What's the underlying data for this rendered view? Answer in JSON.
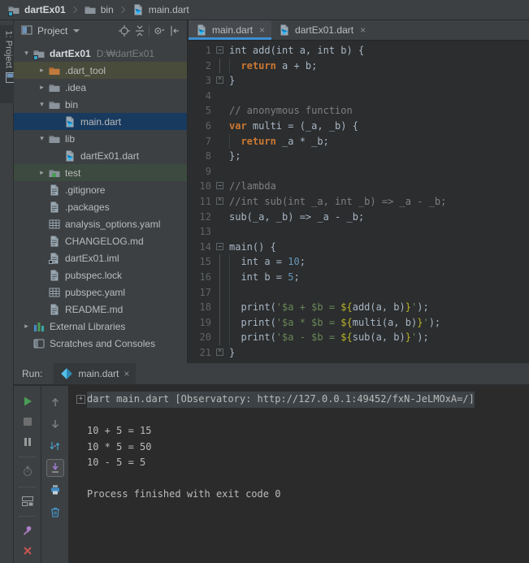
{
  "colors": {
    "accent_blue": "#3D8FD1",
    "selection_bg": "#173A5E",
    "excluded_row_bg": "#494B3B",
    "test_row_bg": "#3C4A40",
    "syntax": {
      "d": "#A9B7C6",
      "k": "#CC7832",
      "n": "#6897BB",
      "c": "#808080",
      "s": "#6A8759",
      "i": "#BBB529"
    },
    "run_green": "#499C54",
    "close_red": "#C75450"
  },
  "breadcrumb": {
    "items": [
      {
        "label": "dartEx01",
        "icon": "folder-project",
        "bold": true
      },
      {
        "label": "bin",
        "icon": "folder",
        "bold": false
      },
      {
        "label": "main.dart",
        "icon": "dart-file",
        "bold": false
      }
    ]
  },
  "tool_window_bar": {
    "project_tab_label": "1: Project"
  },
  "project_panel": {
    "title": "Project",
    "header_icons": [
      "locate",
      "collapse-all",
      "sep",
      "gear",
      "hide-panel"
    ],
    "tree": [
      {
        "indent": 0,
        "arrow": "down",
        "icon": "folder-project",
        "label": "dartEx01",
        "suffix": "D:₩dartEx01",
        "root": true
      },
      {
        "indent": 1,
        "arrow": "right",
        "icon": "folder-excluded",
        "label": ".dart_tool",
        "bg": "excl"
      },
      {
        "indent": 1,
        "arrow": "right",
        "icon": "folder",
        "label": ".idea"
      },
      {
        "indent": 1,
        "arrow": "down",
        "icon": "folder",
        "label": "bin"
      },
      {
        "indent": 2,
        "arrow": "none",
        "icon": "dart-file",
        "label": "main.dart",
        "selected": true
      },
      {
        "indent": 1,
        "arrow": "down",
        "icon": "folder",
        "label": "lib"
      },
      {
        "indent": 2,
        "arrow": "none",
        "icon": "dart-file",
        "label": "dartEx01.dart"
      },
      {
        "indent": 1,
        "arrow": "right",
        "icon": "folder-test",
        "label": "test",
        "bg": "test"
      },
      {
        "indent": 1,
        "arrow": "none",
        "icon": "file-text",
        "label": ".gitignore"
      },
      {
        "indent": 1,
        "arrow": "none",
        "icon": "file-text",
        "label": ".packages"
      },
      {
        "indent": 1,
        "arrow": "none",
        "icon": "file-yaml",
        "label": "analysis_options.yaml"
      },
      {
        "indent": 1,
        "arrow": "none",
        "icon": "file-text",
        "label": "CHANGELOG.md"
      },
      {
        "indent": 1,
        "arrow": "none",
        "icon": "file-iml",
        "label": "dartEx01.iml"
      },
      {
        "indent": 1,
        "arrow": "none",
        "icon": "file-text",
        "label": "pubspec.lock"
      },
      {
        "indent": 1,
        "arrow": "none",
        "icon": "file-yaml",
        "label": "pubspec.yaml"
      },
      {
        "indent": 1,
        "arrow": "none",
        "icon": "file-text",
        "label": "README.md"
      },
      {
        "indent": 0,
        "arrow": "right",
        "icon": "libraries",
        "label": "External Libraries"
      },
      {
        "indent": 0,
        "arrow": "none",
        "icon": "scratches",
        "label": "Scratches and Consoles"
      }
    ]
  },
  "editor": {
    "tabs": [
      {
        "label": "main.dart",
        "icon": "dart-file",
        "active": true
      },
      {
        "label": "dartEx01.dart",
        "icon": "dart-file",
        "active": false
      }
    ],
    "lines": [
      {
        "n": 1,
        "fold": "start",
        "segments": [
          [
            "int add(int a, int b) {",
            "d"
          ]
        ]
      },
      {
        "n": 2,
        "foldline": true,
        "guide": true,
        "segments": [
          [
            "  ",
            "d"
          ],
          [
            "return",
            "k"
          ],
          [
            " a + b;",
            "d"
          ]
        ]
      },
      {
        "n": 3,
        "fold": "end",
        "segments": [
          [
            "}",
            "d"
          ]
        ]
      },
      {
        "n": 4,
        "segments": []
      },
      {
        "n": 5,
        "segments": [
          [
            "// anonymous function",
            "c"
          ]
        ]
      },
      {
        "n": 6,
        "segments": [
          [
            "var",
            "k"
          ],
          [
            " multi = (_a, _b) {",
            "d"
          ]
        ]
      },
      {
        "n": 7,
        "guide": true,
        "segments": [
          [
            "  ",
            "d"
          ],
          [
            "return",
            "k"
          ],
          [
            " _a * _b;",
            "d"
          ]
        ]
      },
      {
        "n": 8,
        "segments": [
          [
            "};",
            "d"
          ]
        ]
      },
      {
        "n": 9,
        "segments": []
      },
      {
        "n": 10,
        "fold": "start",
        "segments": [
          [
            "//lambda",
            "c"
          ]
        ]
      },
      {
        "n": 11,
        "fold": "end",
        "segments": [
          [
            "//int sub(int _a, int _b) => _a - _b;",
            "c"
          ]
        ]
      },
      {
        "n": 12,
        "segments": [
          [
            "sub(_a, _b) => _a - _b;",
            "d"
          ]
        ]
      },
      {
        "n": 13,
        "segments": []
      },
      {
        "n": 14,
        "fold": "start",
        "segments": [
          [
            "main() {",
            "d"
          ]
        ]
      },
      {
        "n": 15,
        "foldline": true,
        "guide": true,
        "segments": [
          [
            "  int a = ",
            "d"
          ],
          [
            "10",
            "n"
          ],
          [
            ";",
            "d"
          ]
        ]
      },
      {
        "n": 16,
        "foldline": true,
        "guide": true,
        "segments": [
          [
            "  int b = ",
            "d"
          ],
          [
            "5",
            "n"
          ],
          [
            ";",
            "d"
          ]
        ]
      },
      {
        "n": 17,
        "foldline": true,
        "guide": true,
        "segments": []
      },
      {
        "n": 18,
        "foldline": true,
        "guide": true,
        "segments": [
          [
            "  print(",
            "d"
          ],
          [
            "'$a + $b = ",
            "s"
          ],
          [
            "${",
            "i"
          ],
          [
            "add(a, b)",
            "d"
          ],
          [
            "}",
            "i"
          ],
          [
            "'",
            "s"
          ],
          [
            ");",
            "d"
          ]
        ]
      },
      {
        "n": 19,
        "foldline": true,
        "guide": true,
        "segments": [
          [
            "  print(",
            "d"
          ],
          [
            "'$a * $b = ",
            "s"
          ],
          [
            "${",
            "i"
          ],
          [
            "multi(a, b)",
            "d"
          ],
          [
            "}",
            "i"
          ],
          [
            "'",
            "s"
          ],
          [
            ");",
            "d"
          ]
        ]
      },
      {
        "n": 20,
        "foldline": true,
        "guide": true,
        "segments": [
          [
            "  print(",
            "d"
          ],
          [
            "'$a - $b = ",
            "s"
          ],
          [
            "${",
            "i"
          ],
          [
            "sub(a, b)",
            "d"
          ],
          [
            "}",
            "i"
          ],
          [
            "'",
            "s"
          ],
          [
            ");",
            "d"
          ]
        ]
      },
      {
        "n": 21,
        "fold": "end",
        "segments": [
          [
            "}",
            "d"
          ]
        ]
      }
    ]
  },
  "run_panel": {
    "label": "Run:",
    "tab": {
      "label": "main.dart",
      "icon": "dart-logo"
    },
    "toolbar_main": [
      "rerun",
      "stop",
      "pause",
      "dots",
      "profiler",
      "dots",
      "layout",
      "dots",
      "pin",
      "close"
    ],
    "toolbar_side": [
      "up",
      "down",
      "cycle",
      "scroll-end",
      "print",
      "clear"
    ],
    "console": [
      {
        "fold": true,
        "highlight": true,
        "text": "dart main.dart [Observatory: http://127.0.0.1:49452/fxN-JeLMOxA=/]"
      },
      {
        "text": ""
      },
      {
        "text": "10 + 5 = 15"
      },
      {
        "text": "10 * 5 = 50"
      },
      {
        "text": "10 - 5 = 5"
      },
      {
        "text": ""
      },
      {
        "text": "Process finished with exit code 0"
      }
    ]
  }
}
